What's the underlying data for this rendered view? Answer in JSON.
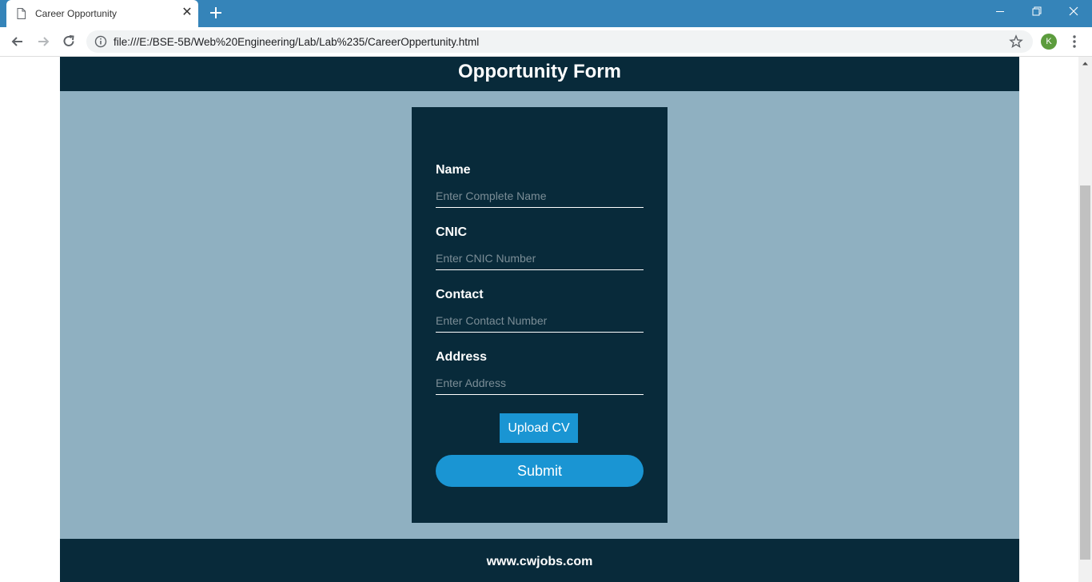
{
  "browser": {
    "tab_title": "Career Opportunity",
    "url": "file:///E:/BSE-5B/Web%20Engineering/Lab/Lab%235/CareerOppertunity.html",
    "profile_initial": "K",
    "accent_color": "#3584b9"
  },
  "header": {
    "title": "Opportunity Form"
  },
  "form": {
    "fields": [
      {
        "label": "Name",
        "placeholder": "Enter Complete Name"
      },
      {
        "label": "CNIC",
        "placeholder": "Enter CNIC Number"
      },
      {
        "label": "Contact",
        "placeholder": "Enter Contact Number"
      },
      {
        "label": "Address",
        "placeholder": "Enter Address"
      }
    ],
    "upload_label": "Upload CV",
    "submit_label": "Submit"
  },
  "footer": {
    "text": "www.cwjobs.com"
  },
  "colors": {
    "dark_navy": "#082a3a",
    "page_background": "#8fb0c1",
    "button_blue": "#1a95d3"
  }
}
